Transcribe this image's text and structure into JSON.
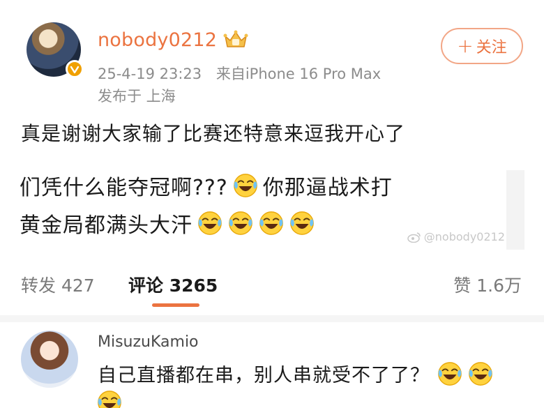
{
  "post": {
    "username": "nobody0212",
    "timestamp": "25-4-19 23:23",
    "source": "来自iPhone 16 Pro Max",
    "location": "发布于 上海",
    "follow_plus": "+",
    "follow_label": "关注",
    "text": "真是谢谢大家输了比赛还特意来逗我开心了",
    "quote_line1": "们凭什么能夺冠啊???",
    "quote_line1_after": "你那逼战术打",
    "quote_line2": "黄金局都满头大汗",
    "watermark": "@nobody0212"
  },
  "stats": {
    "repost_label": "转发",
    "repost_count": "427",
    "comment_label": "评论",
    "comment_count": "3265",
    "like_label": "赞",
    "like_count": "1.6万"
  },
  "comment": {
    "username": "MisuzuKamio",
    "text": "自己直播都在串，别人串就受不了了？"
  },
  "colors": {
    "accent": "#eb7340",
    "muted": "#8c8c8c",
    "verified": "#f0a000"
  },
  "icons": {
    "verified": "verified-badge-icon",
    "crown": "vip-crown-icon",
    "emoji": "laugh-cry-emoji-icon",
    "watermark": "weibo-logo-icon"
  }
}
